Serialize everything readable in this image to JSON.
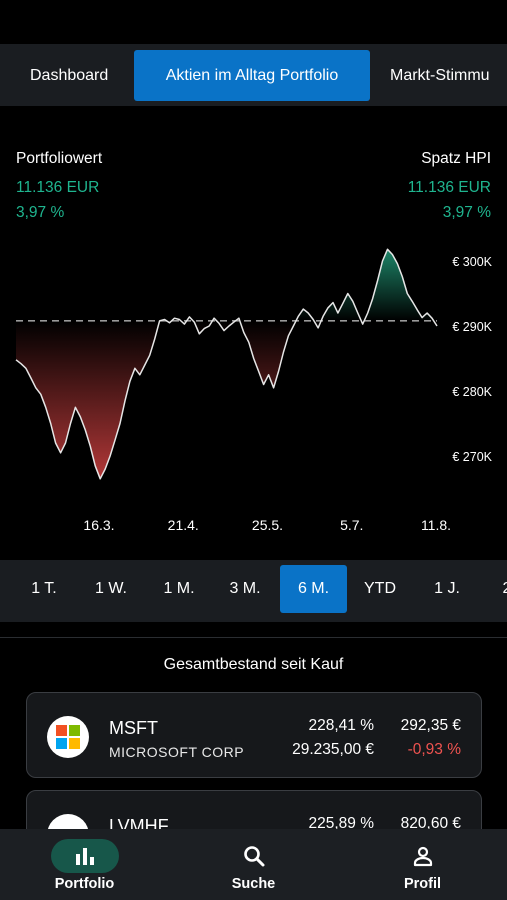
{
  "tabs": [
    {
      "label": "Dashboard",
      "active": false
    },
    {
      "label": "Aktien im Alltag Portfolio",
      "active": true
    },
    {
      "label": "Markt-Stimmu",
      "active": false
    }
  ],
  "portfolio": {
    "left_title": "Portfoliowert",
    "left_value": "11.136 EUR",
    "left_change": "3,97 %",
    "right_title": "Spatz HPI",
    "right_value": "11.136 EUR",
    "right_change": "3,97 %"
  },
  "chart_data": {
    "type": "line",
    "title": "",
    "xlabel": "",
    "ylabel": "",
    "x_tick_labels": [
      "16.3.",
      "21.4.",
      "25.5.",
      "5.7.",
      "11.8."
    ],
    "y_tick_labels": [
      "€ 300K",
      "€ 290K",
      "€ 280K",
      "€ 270K"
    ],
    "y_ticks": [
      300000,
      290000,
      280000,
      270000
    ],
    "ylim": [
      267000,
      305000
    ],
    "baseline": 290800,
    "series": [
      {
        "values": [
          284800,
          284200,
          283500,
          282000,
          280500,
          279500,
          277500,
          275000,
          272000,
          270500,
          272000,
          275000,
          277500,
          276000,
          274000,
          271500,
          268500,
          266500,
          268000,
          270000,
          272500,
          275000,
          278500,
          281500,
          283500,
          282500,
          284000,
          285500,
          288000,
          290800,
          291000,
          290500,
          291200,
          291000,
          290300,
          291400,
          290600,
          288800,
          289600,
          290000,
          291200,
          290400,
          289300,
          290000,
          290600,
          291200,
          289000,
          287500,
          285000,
          283000,
          281000,
          282500,
          280500,
          283000,
          286000,
          288500,
          290000,
          291500,
          292600,
          292000,
          291000,
          289700,
          291500,
          292800,
          293600,
          292000,
          293500,
          295000,
          293800,
          292000,
          290300,
          292000,
          294200,
          297000,
          300000,
          301800,
          301000,
          299600,
          297600,
          295000,
          293800,
          292500,
          291300,
          292000,
          291200,
          290000
        ]
      }
    ],
    "colors": {
      "line": "#e6e6e6",
      "above": "#1f8f70",
      "below": "#b93a3a",
      "baseline": "#9a9a9a"
    }
  },
  "ranges": [
    {
      "label": "1 T.",
      "active": false
    },
    {
      "label": "1 W.",
      "active": false
    },
    {
      "label": "1 M.",
      "active": false
    },
    {
      "label": "3 M.",
      "active": false
    },
    {
      "label": "6 M.",
      "active": true
    },
    {
      "label": "YTD",
      "active": false
    },
    {
      "label": "1 J.",
      "active": false
    },
    {
      "label": "2",
      "active": false
    }
  ],
  "holdings": {
    "title": "Gesamtbestand seit Kauf",
    "items": [
      {
        "ticker": "MSFT",
        "name": "MICROSOFT CORP",
        "pct_total": "228,41 %",
        "price": "292,35 €",
        "value": "29.235,00 €",
        "change": "-0,93 %"
      },
      {
        "ticker": "LVMHF",
        "pct_total": "225,89 %",
        "price": "820,60 €"
      }
    ]
  },
  "nav": [
    {
      "label": "Portfolio",
      "icon": "bar-chart-icon",
      "active": true
    },
    {
      "label": "Suche",
      "icon": "search-icon",
      "active": false
    },
    {
      "label": "Profil",
      "icon": "person-icon",
      "active": false
    }
  ]
}
